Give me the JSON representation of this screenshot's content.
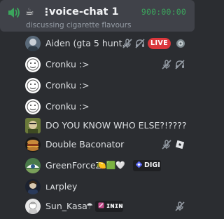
{
  "channel": {
    "emoji": "☕",
    "separator": "⋮",
    "name": "voice-chat 1",
    "timer": "900:00:00",
    "status": "discussing cigarette flavours"
  },
  "colors": {
    "accent_green": "#3ba55c",
    "live_red": "#da373c",
    "header_bg": "#404249",
    "panel_bg": "#2b2d31"
  },
  "users": [
    {
      "name": "Aiden (gta 5 hunt...",
      "muted": true,
      "deafened": true,
      "live_label": "LIVE",
      "activity_icon": "game-activity-icon"
    },
    {
      "name": "Cronku :>",
      "muted": true,
      "deafened": true
    },
    {
      "name": "Cronku :>"
    },
    {
      "name": "Cronku :>"
    },
    {
      "name": "DO YOU KNOW WHO ELSE?!????"
    },
    {
      "name": "Double Baconator",
      "muted": true,
      "activity_icon": "roblox-icon"
    },
    {
      "name": "GreenForceZ",
      "emojis": "🍋🟩🤍",
      "guild_tag": "DIGI"
    },
    {
      "name": "ʟᴀrpley"
    },
    {
      "name": "Sun_Kasa",
      "name_suffix": "☂",
      "guild_tag": "ɪɴɪɴ",
      "muted": true
    }
  ]
}
